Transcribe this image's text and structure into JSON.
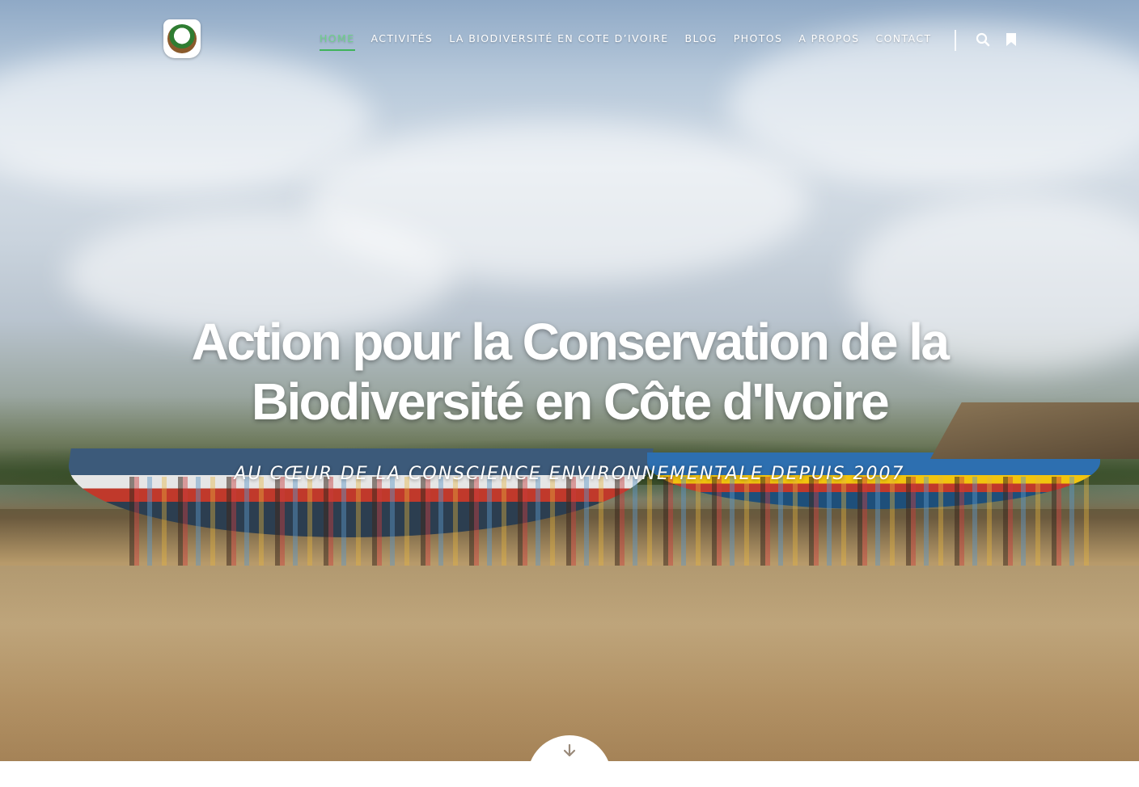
{
  "header": {
    "logo_alt": "logo",
    "nav": [
      {
        "label": "HOME",
        "active": true
      },
      {
        "label": "ACTIVITÉS",
        "active": false
      },
      {
        "label": "LA BIODIVERSITÉ EN COTE D’IVOIRE",
        "active": false
      },
      {
        "label": "BLOG",
        "active": false
      },
      {
        "label": "PHOTOS",
        "active": false
      },
      {
        "label": "A PROPOS",
        "active": false
      },
      {
        "label": "CONTACT",
        "active": false
      }
    ],
    "icons": {
      "search": "search-icon",
      "bookmark": "bookmark-icon"
    }
  },
  "hero": {
    "title_line1": "Action pour la Conservation de la",
    "title_line2": "Biodiversité en Côte d'Ivoire",
    "subtitle": "AU CŒUR DE LA CONSCIENCE ENVIRONNEMENTALE DEPUIS 2007",
    "scroll_icon": "arrow-down-icon"
  },
  "colors": {
    "accent": "#3fb35a",
    "active_nav": "#6fd18a",
    "text": "#ffffff"
  }
}
